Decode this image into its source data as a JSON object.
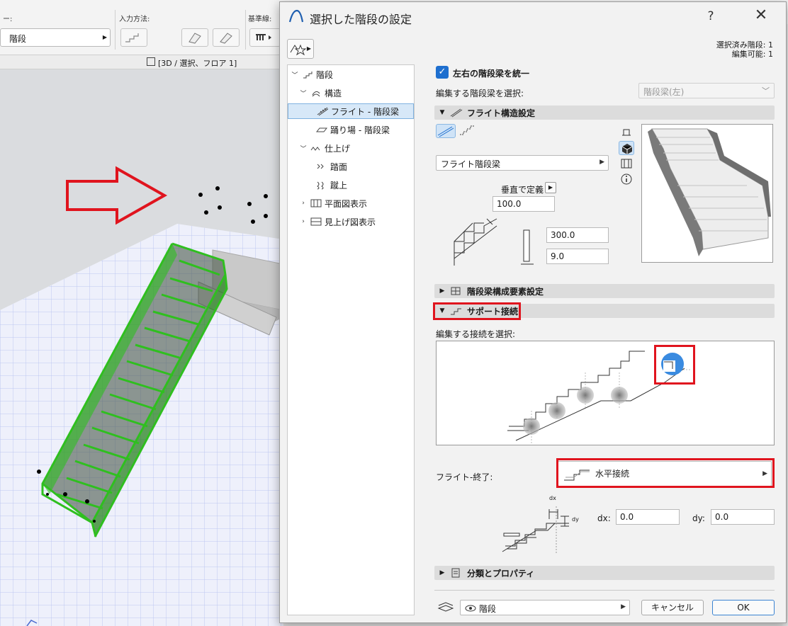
{
  "app": {
    "toolbar": {
      "layer_label": "ー:",
      "input_label": "入力方法:",
      "baseline_label": "基準線:",
      "type_value": "階段",
      "viewport_tab": "[3D / 選択、フロア 1]"
    }
  },
  "dialog": {
    "title": "選択した階段の設定",
    "help": "?",
    "close": "✕",
    "selection_info": [
      "選択済み階段: 1",
      "編集可能: 1"
    ],
    "tree": [
      {
        "label": "階段",
        "icon": "stair-icon",
        "chev": "﹀"
      },
      {
        "label": "構造",
        "icon": "structure-icon",
        "chev": "﹀"
      },
      {
        "label": "フライト - 階段梁",
        "icon": "flight-stringer-icon",
        "chev": ""
      },
      {
        "label": "踊り場 - 階段梁",
        "icon": "landing-stringer-icon",
        "chev": ""
      },
      {
        "label": "仕上げ",
        "icon": "finish-icon",
        "chev": "﹀"
      },
      {
        "label": "踏面",
        "icon": "tread-icon",
        "chev": ""
      },
      {
        "label": "蹴上",
        "icon": "riser-icon",
        "chev": ""
      },
      {
        "label": "平面図表示",
        "icon": "floorplan-icon",
        "chev": "›"
      },
      {
        "label": "見上げ図表示",
        "icon": "ceiling-view-icon",
        "chev": "›"
      }
    ],
    "unify_stringers": "左右の階段梁を統一",
    "edit_stringer_label": "編集する階段梁を選択:",
    "edit_stringer_value": "階段梁(左)",
    "sections": {
      "flight_structure": "フライト構造設定",
      "stringer_components": "階段梁構成要素設定",
      "support_connection": "サポート接続",
      "classification": "分類とプロパティ"
    },
    "flight_type": "フライト階段梁",
    "vertical_define": "垂直で定義",
    "vertical_value": "100.0",
    "height_value": "300.0",
    "thickness_value": "9.0",
    "edit_connection_label": "編集する接続を選択:",
    "flight_end_label": "フライト-終了:",
    "flight_end_value": "水平接続",
    "dx_label": "dx:",
    "dx_value": "0.0",
    "dy_label": "dy:",
    "dy_value": "0.0",
    "diagram_dx": "dx",
    "diagram_dy": "dy",
    "footer": {
      "layer_value": "階段",
      "cancel": "キャンセル",
      "ok": "OK"
    }
  },
  "colors": {
    "accent": "#1e6fcf",
    "highlight_red": "#e0141e",
    "stair_green": "#2fbf1f"
  }
}
